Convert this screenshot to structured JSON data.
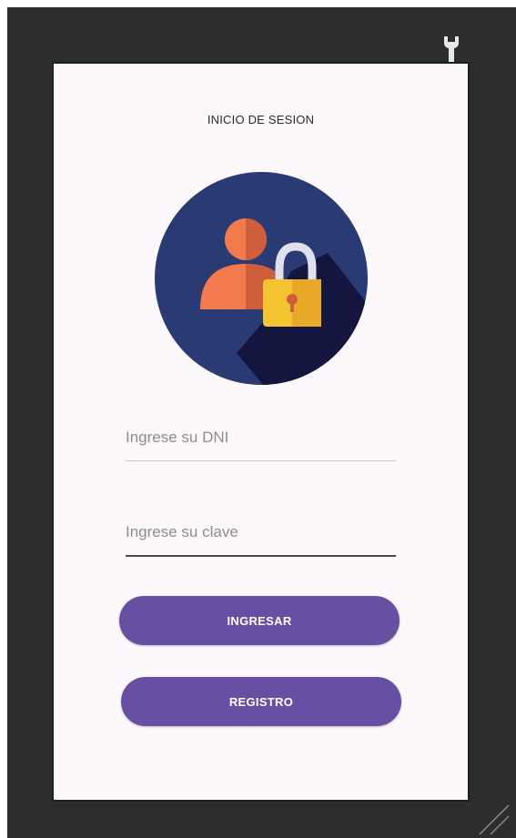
{
  "screen": {
    "title": "INICIO DE SESION"
  },
  "form": {
    "dni": {
      "placeholder": "Ingrese su DNI",
      "value": ""
    },
    "clave": {
      "placeholder": "Ingrese su clave",
      "value": ""
    }
  },
  "buttons": {
    "ingresar": "INGRESAR",
    "registro": "REGISTRO"
  },
  "icons": {
    "toolbar": "wrench-icon",
    "avatar": "user-lock-icon",
    "corner": "resize-grip-icon"
  },
  "colors": {
    "frame": "#2c2d2f",
    "screen_background": "#fcf8fc",
    "primary": "#6750a4",
    "avatar_circle": "#2a3b74",
    "person": "#f27a4c",
    "lock_body": "#f5c531"
  }
}
